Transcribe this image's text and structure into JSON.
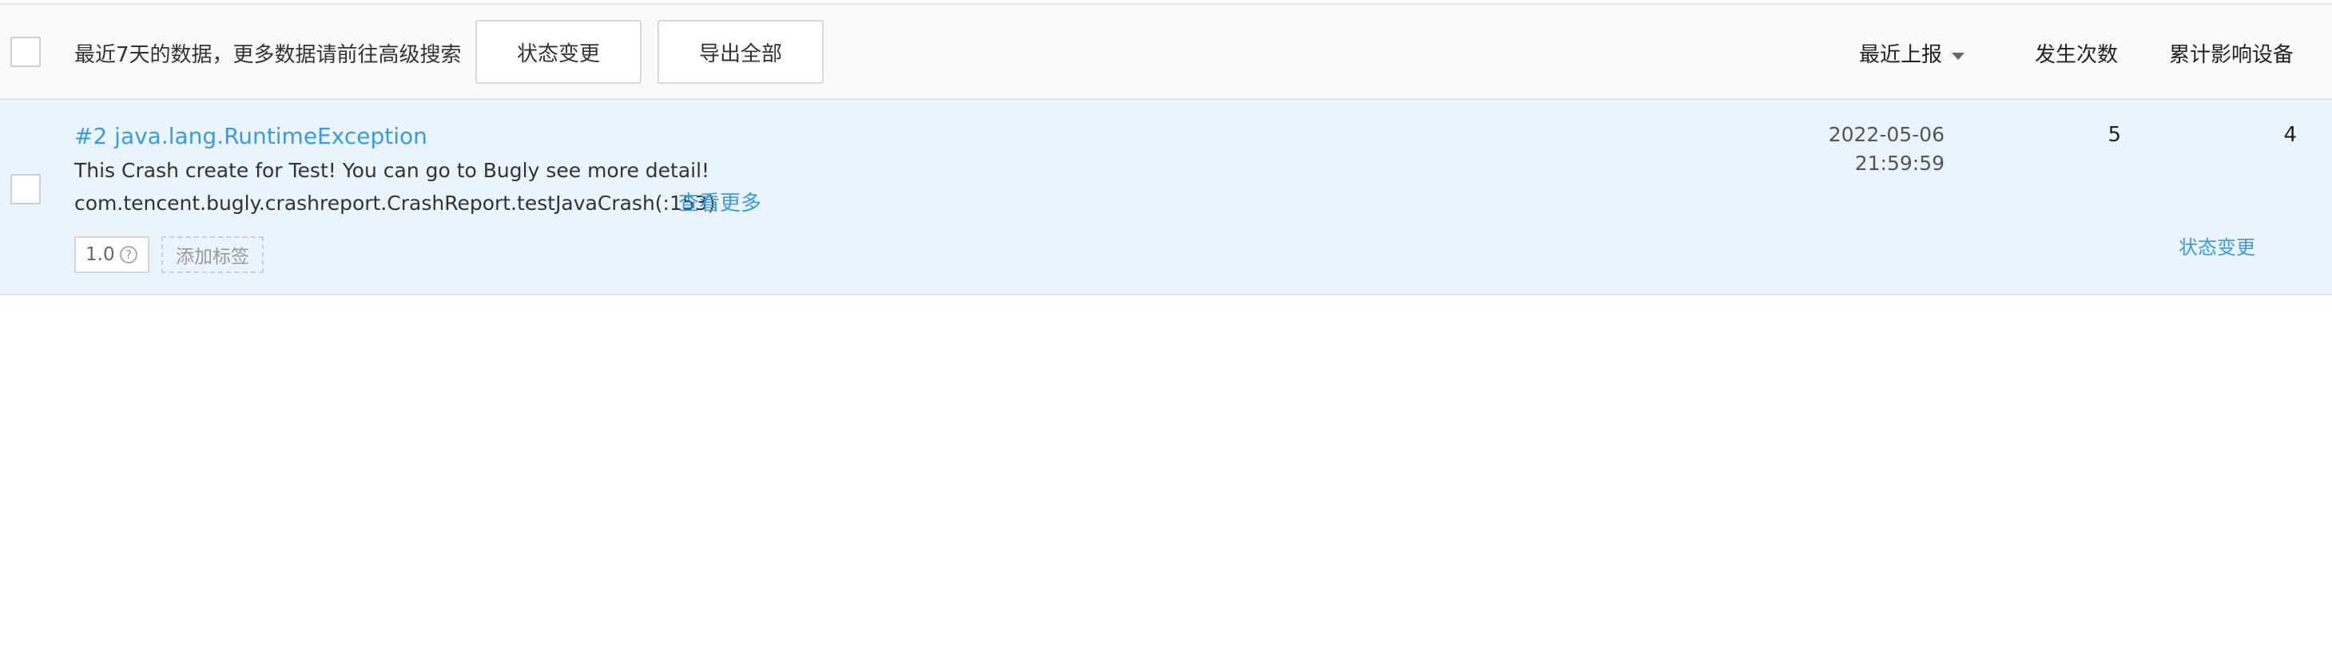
{
  "header": {
    "note": "最近7天的数据，更多数据请前往高级搜索",
    "status_change_button": "状态变更",
    "export_all_button": "导出全部",
    "columns": {
      "recent_report": "最近上报",
      "occurrences": "发生次数",
      "affected_devices": "累计影响设备"
    }
  },
  "issue": {
    "title": "#2 java.lang.RuntimeException",
    "message": "This Crash create for Test! You can go to Bugly see more detail!",
    "stack": "com.tencent.bugly.crashreport.CrashReport.testJavaCrash(:153)",
    "view_more": "查看更多",
    "version_tag": "1.0",
    "help_glyph": "?",
    "add_tag": "添加标签",
    "date": "2022-05-06",
    "time": "21:59:59",
    "occurrences": "5",
    "affected_devices": "4",
    "status_change_link": "状态变更"
  },
  "colors": {
    "accent": "#3b9be1",
    "row_bg": "#eaf4fd",
    "header_bg": "#fafafa"
  },
  "icons": {
    "sort": "caret-down-icon",
    "help": "question-circle-icon"
  }
}
